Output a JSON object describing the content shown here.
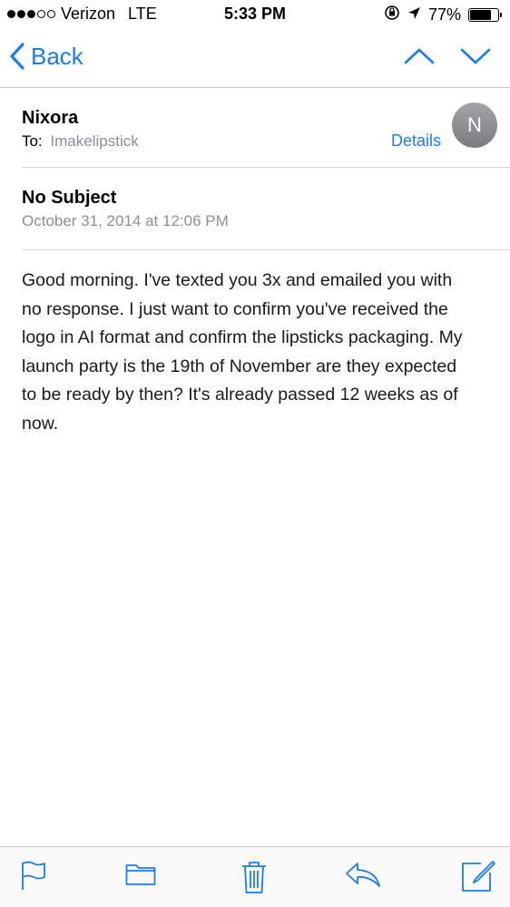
{
  "status_bar": {
    "carrier": "Verizon",
    "network": "LTE",
    "time": "5:33 PM",
    "battery": "77%",
    "battery_level": 0.77
  },
  "nav": {
    "back_label": "Back"
  },
  "message": {
    "sender": "Nixora",
    "to_label": "To:",
    "to_value": "Imakelipstick",
    "details_label": "Details",
    "avatar_initial": "N",
    "subject": "No Subject",
    "date": "October 31, 2014 at 12:06 PM",
    "body": "Good morning. I've texted you 3x and emailed you with no response. I just want to confirm you've received the logo in AI format and confirm the lipsticks packaging. My launch party is the 19th of November are they expected to be ready by then? It's already passed 12 weeks as of now."
  },
  "toolbar": {
    "icons": [
      "flag-icon",
      "folder-icon",
      "trash-icon",
      "reply-icon",
      "compose-icon"
    ]
  },
  "colors": {
    "accent": "#1a7cf4",
    "secondary_text": "#8e8e93"
  }
}
